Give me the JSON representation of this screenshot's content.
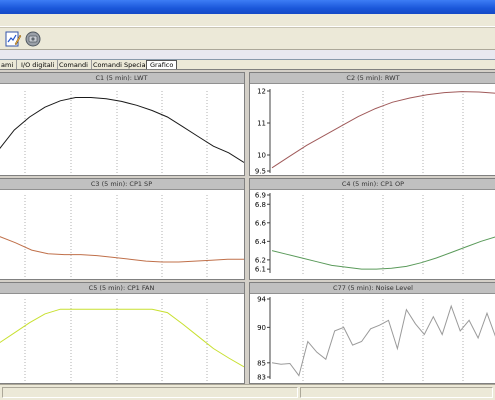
{
  "window": {
    "title": ""
  },
  "toolbar": {
    "buttons": [
      {
        "name": "edit-chart-button",
        "icon": "pencil-chart-icon"
      },
      {
        "name": "connect-button",
        "icon": "gear-plug-icon"
      }
    ]
  },
  "tabs": [
    {
      "label": "ami",
      "active": false
    },
    {
      "label": "I/O digitali",
      "active": false
    },
    {
      "label": "Comandi",
      "active": false
    },
    {
      "label": "Comandi Speciali",
      "active": false
    },
    {
      "label": "Grafico",
      "active": true
    }
  ],
  "panels": [
    {
      "title": "C1 (5 min): LWT",
      "line_color": "#1a1a1a",
      "chart_data": {
        "type": "line",
        "title": "C1 (5 min): LWT",
        "y_ticks": [],
        "values": [
          7.1,
          7.4,
          7.6,
          7.75,
          7.85,
          7.9,
          7.9,
          7.88,
          7.84,
          7.78,
          7.7,
          7.6,
          7.45,
          7.3,
          7.15,
          7.05,
          6.9
        ]
      }
    },
    {
      "title": "C2 (5 min): RWT",
      "line_color": "#a05a5a",
      "chart_data": {
        "type": "line",
        "title": "C2 (5 min): RWT",
        "y_ticks": [
          "12",
          "11",
          "10",
          "9.5"
        ],
        "ylim": [
          9.5,
          12
        ],
        "values": [
          9.6,
          9.95,
          10.3,
          10.6,
          10.9,
          11.2,
          11.45,
          11.65,
          11.78,
          11.88,
          11.95,
          11.98,
          11.97,
          11.93
        ]
      }
    },
    {
      "title": "C3 (5 min): CP1 SP",
      "line_color": "#c0704a",
      "chart_data": {
        "type": "line",
        "title": "C3 (5 min): CP1 SP",
        "y_ticks": [],
        "values": [
          6.45,
          6.38,
          6.3,
          6.26,
          6.25,
          6.25,
          6.24,
          6.22,
          6.2,
          6.18,
          6.17,
          6.17,
          6.18,
          6.19,
          6.2,
          6.2
        ]
      }
    },
    {
      "title": "C4 (5 min): CP1 OP",
      "line_color": "#5a9a5a",
      "chart_data": {
        "type": "line",
        "title": "C4 (5 min): CP1 OP",
        "y_ticks": [
          "6.9",
          "6.8",
          "6.6",
          "6.4",
          "6.2",
          "6.1"
        ],
        "ylim": [
          6.08,
          6.9
        ],
        "values": [
          6.3,
          6.26,
          6.22,
          6.18,
          6.14,
          6.12,
          6.1,
          6.1,
          6.11,
          6.13,
          6.17,
          6.22,
          6.28,
          6.34,
          6.4,
          6.45
        ]
      }
    },
    {
      "title": "C5 (5 min): CP1 FAN",
      "line_color": "#c8e030",
      "chart_data": {
        "type": "line",
        "title": "C5 (5 min): CP1 FAN",
        "y_ticks": [],
        "values": [
          0.5,
          0.65,
          0.8,
          0.93,
          1.0,
          1.0,
          1.0,
          1.0,
          1.0,
          1.0,
          1.0,
          0.95,
          0.78,
          0.6,
          0.42,
          0.28,
          0.15
        ]
      }
    },
    {
      "title": "C77 (5 min): Noise Level",
      "line_color": "#9a9a9a",
      "chart_data": {
        "type": "line",
        "title": "C77 (5 min): Noise Level",
        "y_ticks": [
          "94",
          "90",
          "85",
          "83"
        ],
        "ylim": [
          83,
          94
        ],
        "values": [
          85.0,
          84.8,
          84.9,
          83.2,
          88.0,
          86.5,
          85.5,
          89.5,
          90.0,
          87.5,
          88.0,
          89.8,
          90.3,
          91.0,
          87.0,
          92.5,
          90.5,
          89.0,
          91.5,
          89.0,
          93.0,
          89.5,
          91.0,
          88.5,
          92.0,
          88.5
        ]
      }
    }
  ]
}
